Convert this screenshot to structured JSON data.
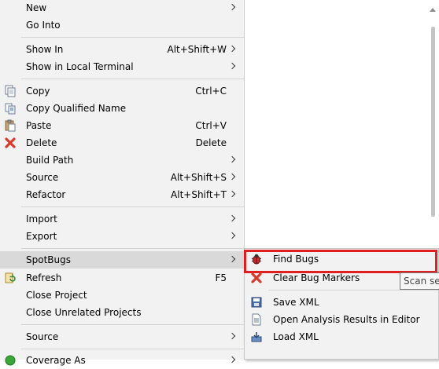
{
  "context_menu": {
    "items": [
      {
        "name": "menu-item-new",
        "label": "New",
        "accel": "",
        "submenu": true,
        "icon": ""
      },
      {
        "name": "menu-item-go-into",
        "label": "Go Into",
        "accel": "",
        "submenu": false,
        "icon": ""
      },
      {
        "name": "menu-item-show-in",
        "label": "Show In",
        "accel": "Alt+Shift+W",
        "submenu": true,
        "icon": ""
      },
      {
        "name": "menu-item-show-in-local-terminal",
        "label": "Show in Local Terminal",
        "accel": "",
        "submenu": true,
        "icon": ""
      },
      {
        "name": "menu-item-copy",
        "label": "Copy",
        "accel": "Ctrl+C",
        "submenu": false,
        "icon": "copy-icon"
      },
      {
        "name": "menu-item-copy-qualified-name",
        "label": "Copy Qualified Name",
        "accel": "",
        "submenu": false,
        "icon": "copy-qualified-name-icon"
      },
      {
        "name": "menu-item-paste",
        "label": "Paste",
        "accel": "Ctrl+V",
        "submenu": false,
        "icon": "paste-icon"
      },
      {
        "name": "menu-item-delete",
        "label": "Delete",
        "accel": "Delete",
        "submenu": false,
        "icon": "delete-icon"
      },
      {
        "name": "menu-item-build-path",
        "label": "Build Path",
        "accel": "",
        "submenu": true,
        "icon": ""
      },
      {
        "name": "menu-item-source",
        "label": "Source",
        "accel": "Alt+Shift+S",
        "submenu": true,
        "icon": ""
      },
      {
        "name": "menu-item-refactor",
        "label": "Refactor",
        "accel": "Alt+Shift+T",
        "submenu": true,
        "icon": ""
      },
      {
        "name": "menu-item-import",
        "label": "Import",
        "accel": "",
        "submenu": true,
        "icon": ""
      },
      {
        "name": "menu-item-export",
        "label": "Export",
        "accel": "",
        "submenu": true,
        "icon": ""
      },
      {
        "name": "menu-item-spotbugs",
        "label": "SpotBugs",
        "accel": "",
        "submenu": true,
        "icon": "",
        "highlighted": true
      },
      {
        "name": "menu-item-refresh",
        "label": "Refresh",
        "accel": "F5",
        "submenu": false,
        "icon": "refresh-icon"
      },
      {
        "name": "menu-item-close-project",
        "label": "Close Project",
        "accel": "",
        "submenu": false,
        "icon": ""
      },
      {
        "name": "menu-item-close-unrelated-projects",
        "label": "Close Unrelated Projects",
        "accel": "",
        "submenu": false,
        "icon": ""
      },
      {
        "name": "menu-item-source-2",
        "label": "Source",
        "accel": "",
        "submenu": true,
        "icon": ""
      },
      {
        "name": "menu-item-coverage-as",
        "label": "Coverage As",
        "accel": "",
        "submenu": true,
        "icon": "coverage-icon"
      }
    ]
  },
  "spotbugs_submenu": {
    "items": [
      {
        "name": "submenu-item-find-bugs",
        "label": "Find Bugs",
        "icon": "bug-icon",
        "highlighted": true
      },
      {
        "name": "submenu-item-clear-bug-markers",
        "label": "Clear Bug Markers",
        "icon": "clear-icon"
      },
      {
        "name": "submenu-item-save-xml",
        "label": "Save XML",
        "icon": "save-icon"
      },
      {
        "name": "submenu-item-open-analysis-results",
        "label": "Open Analysis Results in Editor",
        "icon": "document-icon"
      },
      {
        "name": "submenu-item-load-xml",
        "label": "Load XML",
        "icon": "load-icon"
      }
    ]
  },
  "tooltip": {
    "text": "Scan selected"
  },
  "colors": {
    "menu_bg": "#f2f2f2",
    "highlight": "#d9d9d9",
    "annotation_outline": "#e02020"
  }
}
